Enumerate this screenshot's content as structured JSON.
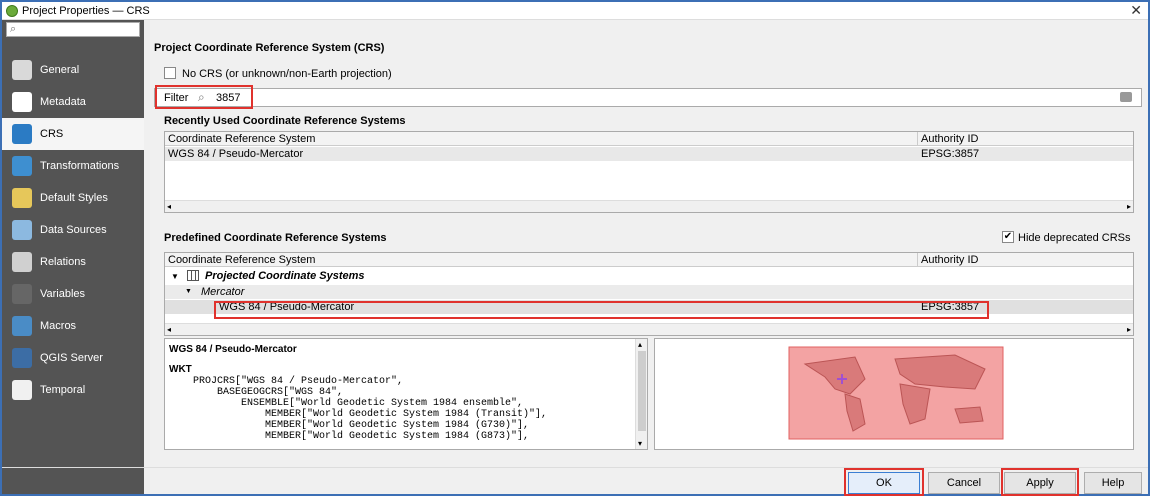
{
  "window": {
    "title": "Project Properties — CRS"
  },
  "sidebar": {
    "search_placeholder": "",
    "items": [
      {
        "label": "General",
        "icon": "wrench-icon",
        "color": "#d9d9d9"
      },
      {
        "label": "Metadata",
        "icon": "document-icon",
        "color": "#ffffff"
      },
      {
        "label": "CRS",
        "icon": "globe-icon",
        "color": "#2b7bc4"
      },
      {
        "label": "Transformations",
        "icon": "globe-transform-icon",
        "color": "#3e8fd0"
      },
      {
        "label": "Default Styles",
        "icon": "brush-icon",
        "color": "#e6c75a"
      },
      {
        "label": "Data Sources",
        "icon": "database-icon",
        "color": "#8cb9e0"
      },
      {
        "label": "Relations",
        "icon": "relations-icon",
        "color": "#d0d0d0"
      },
      {
        "label": "Variables",
        "icon": "epsilon-icon",
        "color": "#666666"
      },
      {
        "label": "Macros",
        "icon": "gears-icon",
        "color": "#4a8cc6"
      },
      {
        "label": "QGIS Server",
        "icon": "server-icon",
        "color": "#3c6da5"
      },
      {
        "label": "Temporal",
        "icon": "clock-icon",
        "color": "#f0f0f0"
      }
    ]
  },
  "crs": {
    "section_title": "Project Coordinate Reference System (CRS)",
    "no_crs_label": "No CRS (or unknown/non-Earth projection)",
    "filter_label": "Filter",
    "filter_value": "3857",
    "recent_title": "Recently Used Coordinate Reference Systems",
    "recent_headers": [
      "Coordinate Reference System",
      "Authority ID"
    ],
    "recent_rows": [
      {
        "name": "WGS 84 / Pseudo-Mercator",
        "auth": "EPSG:3857"
      }
    ],
    "predefined_title": "Predefined Coordinate Reference Systems",
    "hide_deprecated_label": "Hide deprecated CRSs",
    "predefined_headers": [
      "Coordinate Reference System",
      "Authority ID"
    ],
    "tree_group": "Projected Coordinate Systems",
    "tree_subgroup": "Mercator",
    "tree_item": {
      "name": "WGS 84 / Pseudo-Mercator",
      "auth": "EPSG:3857"
    },
    "details_title": "WGS 84 / Pseudo-Mercator",
    "wkt_label": "WKT",
    "wkt_lines": [
      "    PROJCRS[\"WGS 84 / Pseudo-Mercator\",",
      "        BASEGEOGCRS[\"WGS 84\",",
      "            ENSEMBLE[\"World Geodetic System 1984 ensemble\",",
      "                MEMBER[\"World Geodetic System 1984 (Transit)\"],",
      "                MEMBER[\"World Geodetic System 1984 (G730)\"],",
      "                MEMBER[\"World Geodetic System 1984 (G873)\"],"
    ]
  },
  "buttons": {
    "ok": "OK",
    "cancel": "Cancel",
    "apply": "Apply",
    "help": "Help"
  }
}
